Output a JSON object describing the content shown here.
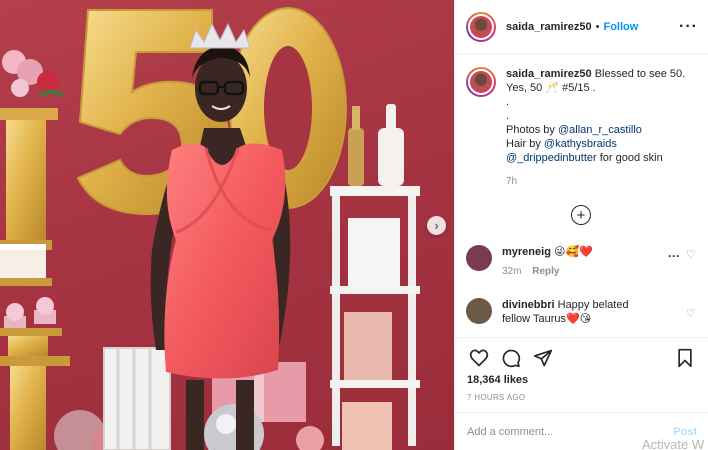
{
  "post": {
    "username": "saida_ramirez50",
    "separator": "•",
    "follow_label": "Follow",
    "more_icon": "more-horizontal-icon",
    "next_icon": "chevron-right-icon"
  },
  "caption": {
    "username": "saida_ramirez50",
    "text_line1": "Blessed to see 50.",
    "text_line2": "Yes, 50 🥂 #5/15 .",
    "dot1": ".",
    "dot2": ".",
    "photos_prefix": "Photos by ",
    "photos_handle": "@allan_r_castillo",
    "hair_prefix": "Hair by ",
    "hair_handle": "@kathysbraids",
    "skin_handle": "@_drippedinbutter",
    "skin_suffix": " for good skin",
    "time": "7h"
  },
  "load_more_icon": "plus-circle-icon",
  "comments": [
    {
      "username": "myreneig",
      "text": "😜🥰❤️",
      "time": "32m",
      "reply_label": "Reply",
      "avatar_color": "#7a3b52"
    },
    {
      "username": "divinebbri",
      "text": "Happy belated fellow Taurus❤️😘",
      "avatar_color": "#6b5a48"
    }
  ],
  "actions": {
    "like_icon": "heart-icon",
    "comment_icon": "comment-icon",
    "share_icon": "send-icon",
    "save_icon": "bookmark-icon"
  },
  "likes": "18,364 likes",
  "post_time": "7 HOURS AGO",
  "comment_box": {
    "placeholder": "Add a comment...",
    "post_label": "Post"
  },
  "watermark": "Activate W",
  "colors": {
    "accent": "#0095f6",
    "post_disabled": "#b2dffc",
    "photo_background": "#a63442"
  }
}
